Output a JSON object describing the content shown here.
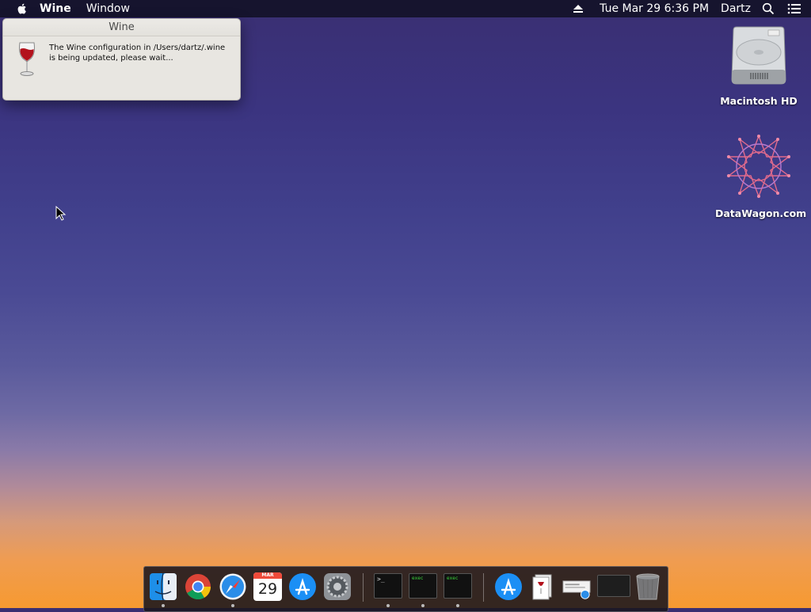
{
  "menubar": {
    "app_name": "Wine",
    "menus": [
      "Window"
    ],
    "clock": "Tue Mar 29  6:36 PM",
    "user": "Dartz"
  },
  "dialog": {
    "title": "Wine",
    "message_line1": "The Wine configuration in /Users/dartz/.wine",
    "message_line2": "is being updated, please wait..."
  },
  "desktop": {
    "icons": [
      {
        "label": "Macintosh HD",
        "icon": "hard-drive-icon"
      },
      {
        "label": "DataWagon.com",
        "icon": "datawagon-star-icon"
      }
    ]
  },
  "dock": {
    "calendar_month": "MAR",
    "calendar_day": "29",
    "terminal_prompt": ">_",
    "exec_label_1": "exec",
    "exec_label_2": "exec"
  }
}
